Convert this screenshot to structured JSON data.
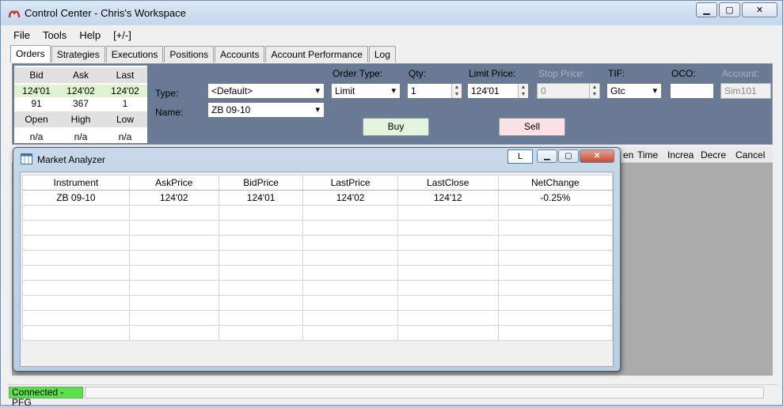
{
  "window": {
    "title": "Control Center - Chris's Workspace",
    "minimize": "▁",
    "maximize": "▢",
    "close": "✕"
  },
  "menu": [
    "File",
    "Tools",
    "Help",
    "[+/-]"
  ],
  "tabs": [
    "Orders",
    "Strategies",
    "Executions",
    "Positions",
    "Accounts",
    "Account Performance",
    "Log"
  ],
  "quote": {
    "headers": [
      "Bid",
      "Ask",
      "Last"
    ],
    "prices": [
      "124'01",
      "124'02",
      "124'02"
    ],
    "sizes": [
      "91",
      "367",
      "1"
    ],
    "headers2": [
      "Open",
      "High",
      "Low"
    ],
    "values2": [
      "n/a",
      "n/a",
      "n/a"
    ]
  },
  "order": {
    "type_label": "Type:",
    "type_value": "<Default>",
    "name_label": "Name:",
    "name_value": "ZB 09-10",
    "order_type_label": "Order Type:",
    "order_type_value": "Limit",
    "qty_label": "Qty:",
    "qty_value": "1",
    "limit_label": "Limit Price:",
    "limit_value": "124'01",
    "stop_label": "Stop Price:",
    "stop_value": "0",
    "tif_label": "TIF:",
    "tif_value": "Gtc",
    "oco_label": "OCO:",
    "oco_value": "",
    "account_label": "Account:",
    "account_value": "Sim101",
    "buy": "Buy",
    "sell": "Sell"
  },
  "bg_grid_headers": [
    "en",
    "Time",
    "Increa",
    "Decre",
    "Cancel"
  ],
  "status": {
    "connection": "Connected - PFG",
    "color": "#5ce04a"
  },
  "market_analyzer": {
    "title": "Market Analyzer",
    "link_button": "L",
    "columns": [
      "Instrument",
      "AskPrice",
      "BidPrice",
      "LastPrice",
      "LastClose",
      "NetChange"
    ],
    "rows": [
      [
        "ZB 09-10",
        "124'02",
        "124'01",
        "124'02",
        "124'12",
        "-0.25%"
      ]
    ]
  }
}
